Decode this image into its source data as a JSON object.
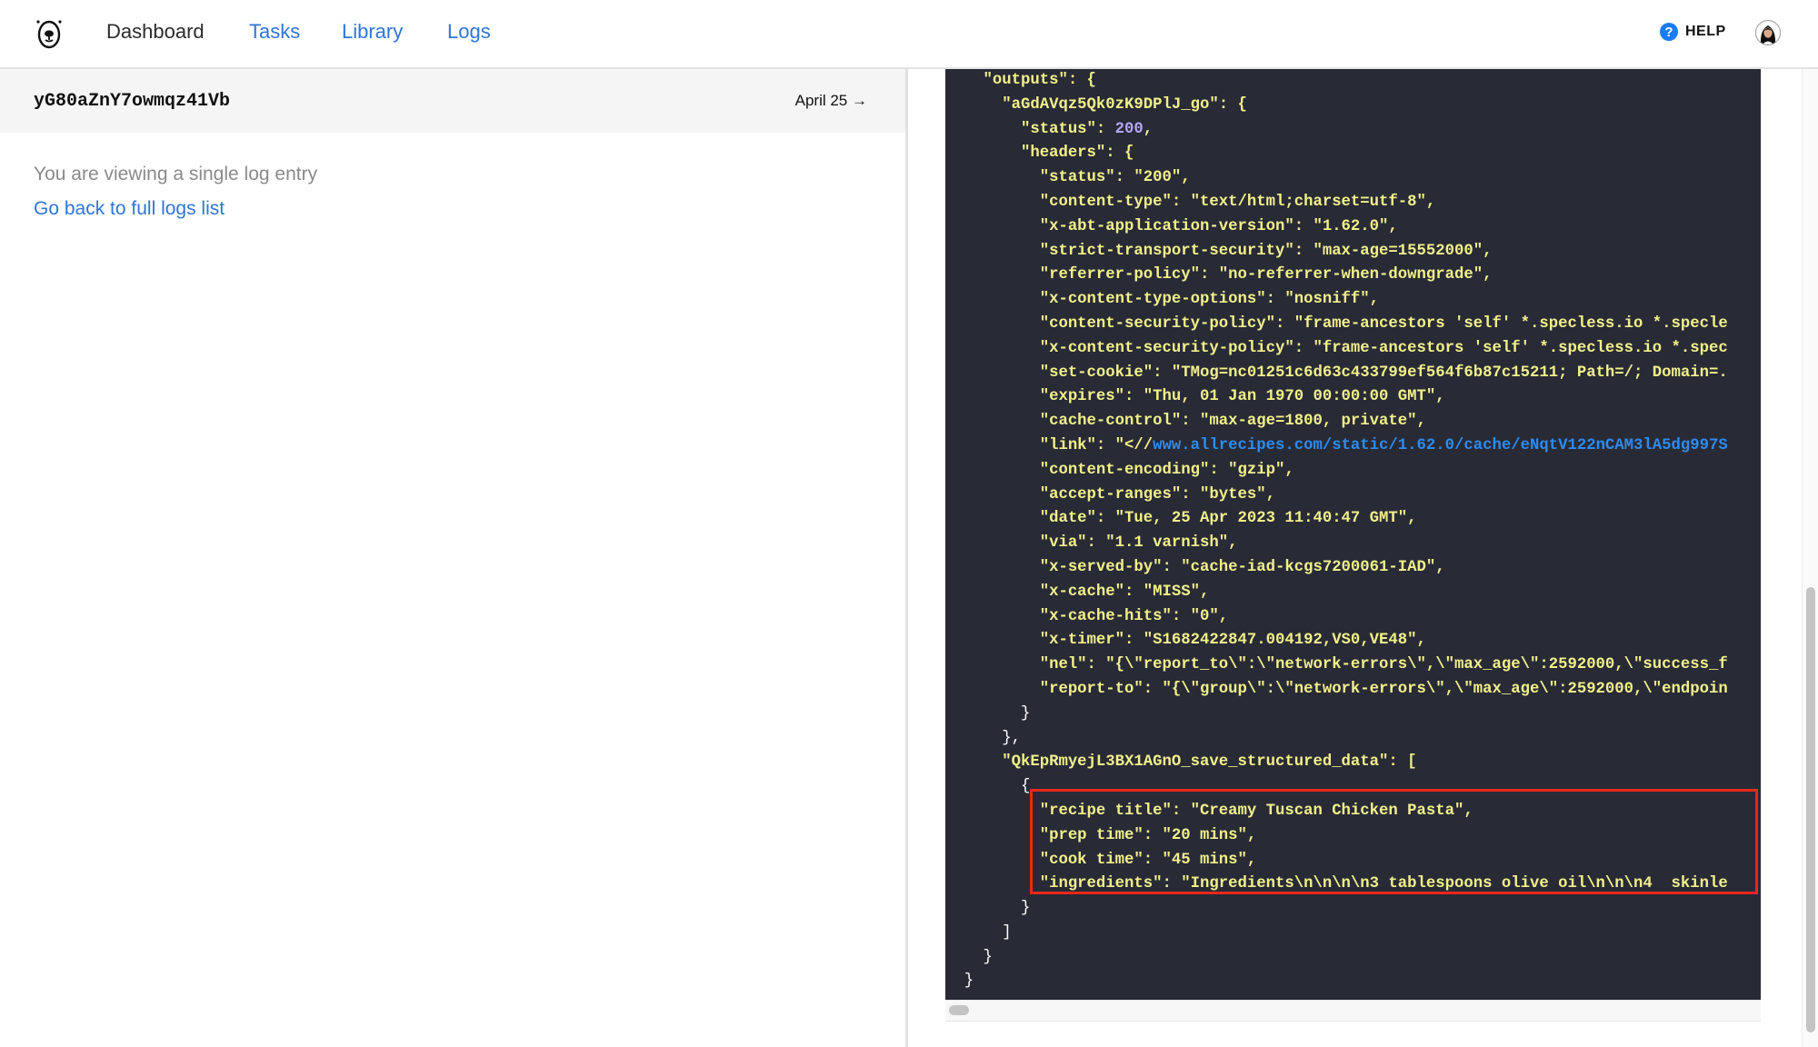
{
  "header": {
    "nav": [
      {
        "label": "Dashboard",
        "active": true
      },
      {
        "label": "Tasks",
        "active": false
      },
      {
        "label": "Library",
        "active": false
      },
      {
        "label": "Logs",
        "active": false
      }
    ],
    "help_icon": "?",
    "help_label": "HELP",
    "logo_icon": "bear-logo-icon",
    "avatar_icon": "user-avatar"
  },
  "entry": {
    "id": "yG80aZnY7owmqz41Vb",
    "date_link": "April 25 →",
    "viewing_text": "You are viewing a single log entry",
    "back_link": "Go back to full logs list"
  },
  "code": {
    "lines": [
      "    \"outputs\": {",
      "      \"aGdAVqz5Qk0zK9DPlJ_go\": {",
      "        \"status\": 200,",
      "        \"headers\": {",
      "          \"status\": \"200\",",
      "          \"content-type\": \"text/html;charset=utf-8\",",
      "          \"x-abt-application-version\": \"1.62.0\",",
      "          \"strict-transport-security\": \"max-age=15552000\",",
      "          \"referrer-policy\": \"no-referrer-when-downgrade\",",
      "          \"x-content-type-options\": \"nosniff\",",
      "          \"content-security-policy\": \"frame-ancestors 'self' *.specless.io *.specle",
      "          \"x-content-security-policy\": \"frame-ancestors 'self' *.specless.io *.spec",
      "          \"set-cookie\": \"TMog=nc01251c6d63c433799ef564f6b87c15211; Path=/; Domain=.",
      "          \"expires\": \"Thu, 01 Jan 1970 00:00:00 GMT\",",
      "          \"cache-control\": \"max-age=1800, private\",",
      "          \"link\": \"<//www.allrecipes.com/static/1.62.0/cache/eNqtV122nCAM3lA5dg997S",
      "          \"content-encoding\": \"gzip\",",
      "          \"accept-ranges\": \"bytes\",",
      "          \"date\": \"Tue, 25 Apr 2023 11:40:47 GMT\",",
      "          \"via\": \"1.1 varnish\",",
      "          \"x-served-by\": \"cache-iad-kcgs7200061-IAD\",",
      "          \"x-cache\": \"MISS\",",
      "          \"x-cache-hits\": \"0\",",
      "          \"x-timer\": \"S1682422847.004192,VS0,VE48\",",
      "          \"nel\": \"{\\\"report_to\\\":\\\"network-errors\\\",\\\"max_age\\\":2592000,\\\"success_f",
      "          \"report-to\": \"{\\\"group\\\":\\\"network-errors\\\",\\\"max_age\\\":2592000,\\\"endpoin",
      "        }",
      "      },",
      "      \"QkEpRmyejL3BX1AGnO_save_structured_data\": [",
      "        {",
      "          \"recipe title\": \"Creamy Tuscan Chicken Pasta\",",
      "          \"prep time\": \"20 mins\",",
      "          \"cook time\": \"45 mins\",",
      "          \"ingredients\": \"Ingredients\\n\\n\\n\\n3 tablespoons olive oil\\n\\n\\n4  skinle",
      "        }",
      "      ]",
      "    }",
      "  }"
    ]
  },
  "colors": {
    "code_bg": "#282a36",
    "code_text": "#f1f08a",
    "number": "#b3a6f5",
    "url": "#2d8cf0",
    "link": "#2f74d8",
    "highlight_border": "#e8271a",
    "help_icon_bg": "#1a7cf5"
  }
}
